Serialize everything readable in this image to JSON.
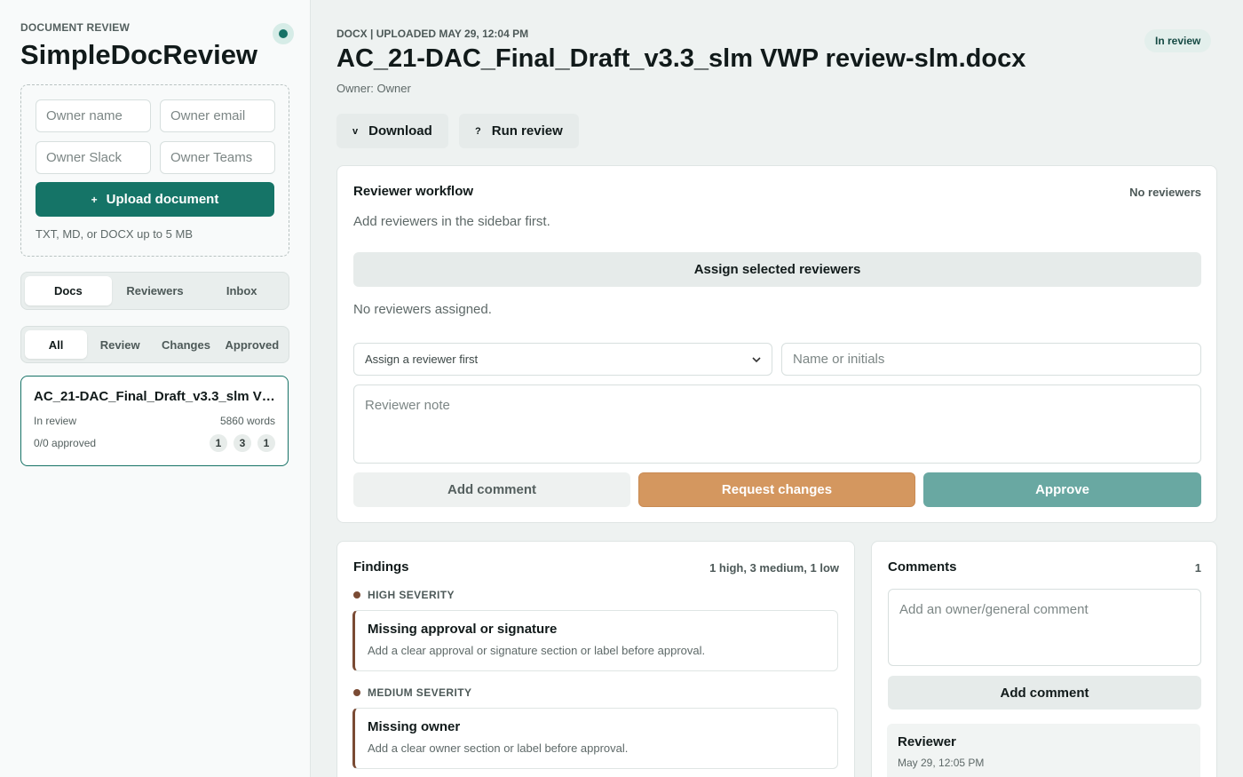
{
  "sidebar": {
    "kicker": "DOCUMENT REVIEW",
    "brand": "SimpleDocReview",
    "inputs": {
      "owner_name": "Owner name",
      "owner_email": "Owner email",
      "owner_slack": "Owner Slack",
      "owner_teams": "Owner Teams"
    },
    "upload_icon": "+",
    "upload_label": "Upload document",
    "upload_hint": "TXT, MD, or DOCX up to 5 MB",
    "view_tabs": [
      "Docs",
      "Reviewers",
      "Inbox"
    ],
    "filter_tabs": [
      "All",
      "Review",
      "Changes",
      "Approved"
    ],
    "doc": {
      "title": "AC_21-DAC_Final_Draft_v3.3_slm VWP review-slm.docx",
      "status": "In review",
      "words": "5860 words",
      "approved": "0/0 approved",
      "counts": [
        "1",
        "3",
        "1"
      ]
    }
  },
  "header": {
    "meta": "DOCX | UPLOADED MAY 29, 12:04 PM",
    "title": "AC_21-DAC_Final_Draft_v3.3_slm VWP review-slm.docx",
    "owner": "Owner: Owner",
    "status": "In review",
    "download_icon": "v",
    "download_label": "Download",
    "run_icon": "?",
    "run_label": "Run review"
  },
  "workflow": {
    "title": "Reviewer workflow",
    "aside": "No reviewers",
    "hint": "Add reviewers in the sidebar first.",
    "assign_label": "Assign selected reviewers",
    "none_assigned": "No reviewers assigned.",
    "select_value": "Assign a reviewer first",
    "name_placeholder": "Name or initials",
    "note_placeholder": "Reviewer note",
    "add_comment": "Add comment",
    "request_changes": "Request changes",
    "approve": "Approve"
  },
  "findings": {
    "title": "Findings",
    "summary": "1 high, 3 medium, 1 low",
    "groups": [
      {
        "severity": "HIGH SEVERITY",
        "title": "Missing approval or signature",
        "desc": "Add a clear approval or signature section or label before approval."
      },
      {
        "severity": "MEDIUM SEVERITY",
        "title": "Missing owner",
        "desc": "Add a clear owner section or label before approval."
      }
    ]
  },
  "comments": {
    "title": "Comments",
    "count": "1",
    "placeholder": "Add an owner/general comment",
    "add_label": "Add comment",
    "items": [
      {
        "author": "Reviewer",
        "time": "May 29, 12:05 PM"
      }
    ]
  },
  "colors": {
    "accent": "#157467",
    "request_changes": "#d4975f",
    "approve": "#69a8a2",
    "severity": "#7a4b34"
  }
}
